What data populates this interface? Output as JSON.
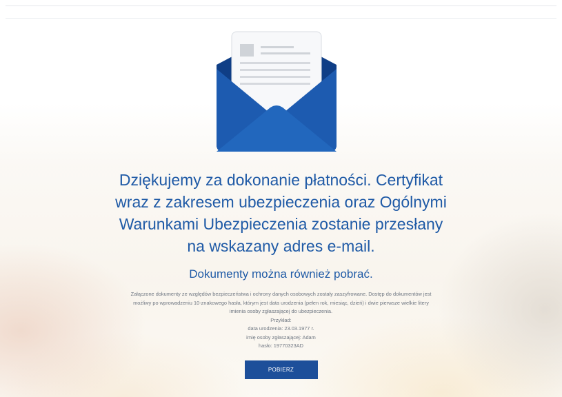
{
  "colors": {
    "accent": "#1f5aa6",
    "button": "#1d4f9a",
    "envelope_dark": "#0f3e86",
    "envelope_light": "#1d5bb0"
  },
  "icon": "envelope-with-letter-icon",
  "message": {
    "headline_lines": [
      "Dziękujemy za dokonanie płatności. Certyfikat",
      "wraz z zakresem ubezpieczenia oraz Ogólnymi",
      "Warunkami Ubezpieczenia zostanie przesłany",
      "na wskazany adres e-mail."
    ],
    "subheadline": "Dokumenty można również pobrać."
  },
  "info": {
    "paragraph_lines": [
      "Załączone dokumenty ze względów bezpieczeństwa i ochrony danych osobowych zostały zaszyfrowane. Dostęp do dokumentów jest",
      "możliwy po wprowadzeniu 10-znakowego hasła, którym jest data urodzenia (pełen rok, miesiąc, dzień) i dwie pierwsze wielkie litery",
      "imienia osoby zgłaszającej do ubezpieczenia."
    ],
    "example_title": "Przykład:",
    "example_birthdate": "data urodzenia: 23.03.1977 r.",
    "example_name": "imię osoby zgłaszającej: Adam",
    "example_password": "hasło: 19770323AD"
  },
  "actions": {
    "download_label": "POBIERZ"
  }
}
